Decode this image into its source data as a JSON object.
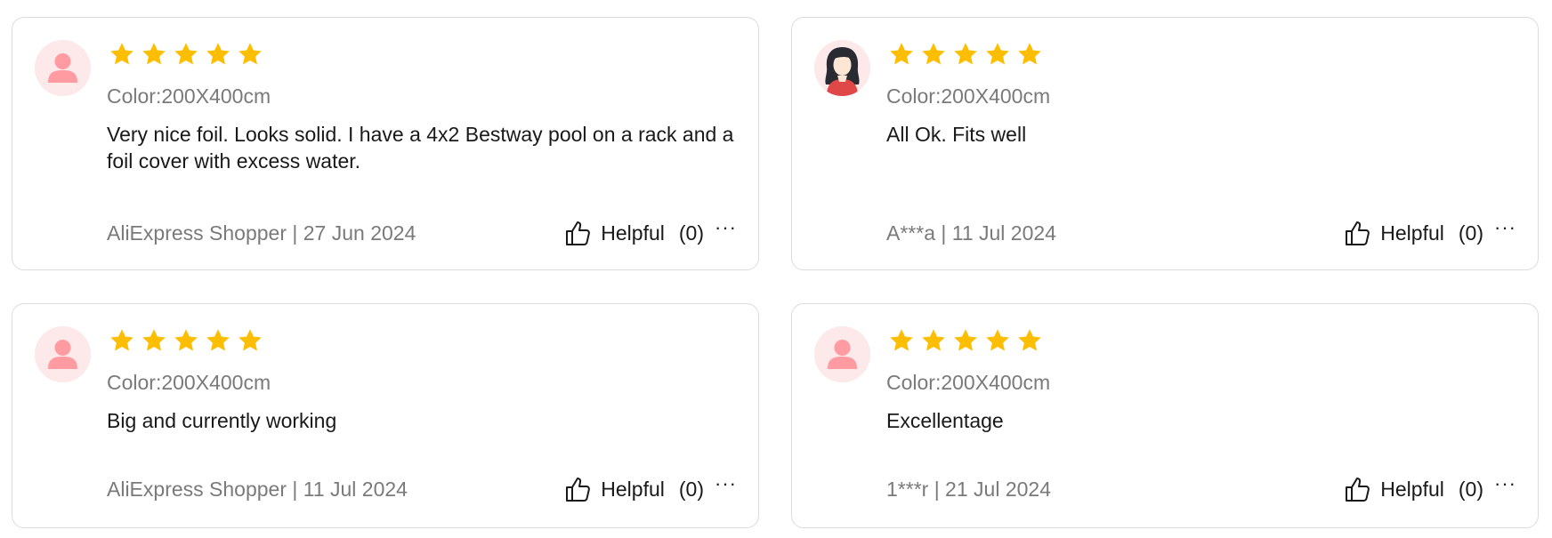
{
  "colors": {
    "star": "#fdbe00",
    "avatar_bg": "#fde8ea",
    "avatar_figure": "#ff9ba1",
    "secondary_text": "#7a7a7a",
    "border": "#dcdcdc"
  },
  "reviews": [
    {
      "avatar": "default-user-icon",
      "rating": 5,
      "sku": "Color:200X400cm",
      "text": "Very nice foil. Looks solid. I have a 4x2 Bestway pool on a rack and a foil cover with excess water.",
      "author_date": "AliExpress Shopper | 27 Jun 2024",
      "helpful_label": "Helpful",
      "helpful_count": "(0)",
      "more": "···"
    },
    {
      "avatar": "woman-avatar-icon",
      "rating": 5,
      "sku": "Color:200X400cm",
      "text": "All Ok. Fits well",
      "author_date": "A***a | 11 Jul 2024",
      "helpful_label": "Helpful",
      "helpful_count": "(0)",
      "more": "···"
    },
    {
      "avatar": "default-user-icon",
      "rating": 5,
      "sku": "Color:200X400cm",
      "text": "Big and currently working",
      "author_date": "AliExpress Shopper | 11 Jul 2024",
      "helpful_label": "Helpful",
      "helpful_count": "(0)",
      "more": "···"
    },
    {
      "avatar": "default-user-icon",
      "rating": 5,
      "sku": "Color:200X400cm",
      "text": "Excellentage",
      "author_date": "1***r | 21 Jul 2024",
      "helpful_label": "Helpful",
      "helpful_count": "(0)",
      "more": "···"
    }
  ]
}
